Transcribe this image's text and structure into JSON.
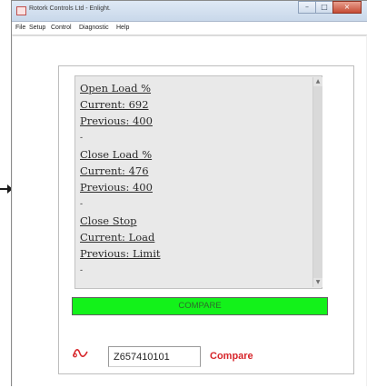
{
  "window": {
    "title": "Rotork Controls Ltd - Enlight.",
    "controls": {
      "minimize": "–",
      "maximize": "□",
      "close": "×"
    }
  },
  "menu": [
    "File",
    "Setup",
    "Control",
    "Diagnostic",
    "Help"
  ],
  "readout": {
    "lines": [
      "Open Load %",
      "Current: 692",
      "Previous: 400",
      "-",
      "Close Load %",
      "Current: 476",
      "Previous: 400",
      "-",
      "Close Stop",
      "Current: Load",
      "Previous: Limit",
      "-"
    ]
  },
  "scroll": {
    "up": "▲",
    "down": "▼"
  },
  "compare_bar": {
    "label": "COMPARE",
    "color": "#13f21a"
  },
  "serial": {
    "value": "Z657410101"
  },
  "compare_link": {
    "label": "Compare",
    "color": "#d7262b"
  },
  "icons": {
    "signal": "signal-wave-icon",
    "pointer": "arrow-right-icon"
  }
}
